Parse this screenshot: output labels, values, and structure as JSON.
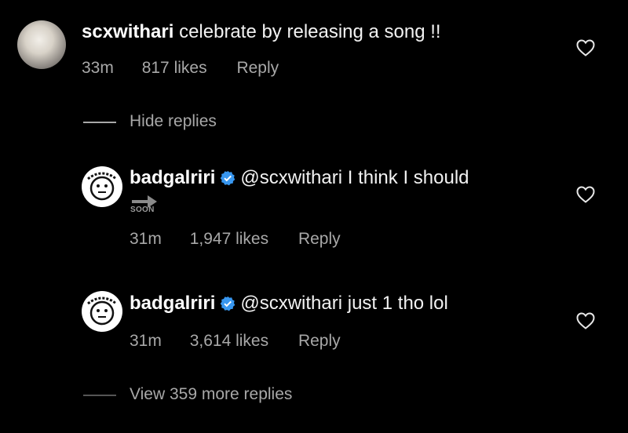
{
  "comment": {
    "username": "scxwithari",
    "text": "celebrate by releasing a song !!",
    "time": "33m",
    "likes": "817 likes",
    "reply_label": "Reply"
  },
  "hide_replies_label": "Hide replies",
  "replies": [
    {
      "username": "badgalriri",
      "verified": true,
      "text": "@scxwithari I think I should",
      "sticker_text": "SOON",
      "time": "31m",
      "likes": "1,947 likes",
      "reply_label": "Reply"
    },
    {
      "username": "badgalriri",
      "verified": true,
      "text": "@scxwithari just 1 tho lol",
      "time": "31m",
      "likes": "3,614 likes",
      "reply_label": "Reply"
    }
  ],
  "view_more_label": "View 359 more replies",
  "colors": {
    "background": "#000000",
    "primary_text": "#f5f5f5",
    "secondary_text": "#a8a8a8",
    "verified_badge": "#3897f0"
  }
}
